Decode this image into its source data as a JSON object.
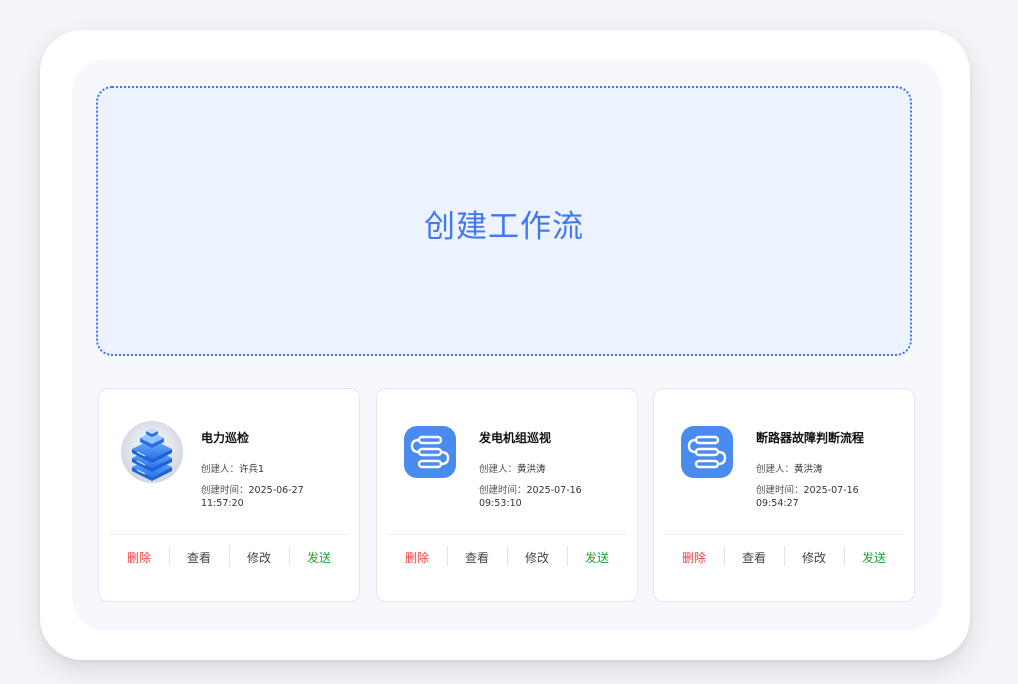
{
  "create_area": {
    "label": "创建工作流"
  },
  "labels": {
    "creator": "创建人：",
    "created_time": "创建时间："
  },
  "actions": {
    "delete": "删除",
    "view": "查看",
    "edit": "修改",
    "send": "发送"
  },
  "cards": [
    {
      "title": "电力巡检",
      "creator": "许兵1",
      "created_date": "2025-06-27",
      "created_clock": "11:57:20",
      "icon": "server-stack-icon"
    },
    {
      "title": "发电机组巡视",
      "creator": "黄洪涛",
      "created_date": "2025-07-16",
      "created_clock": "09:53:10",
      "icon": "workflow-icon"
    },
    {
      "title": "断路器故障判断流程",
      "creator": "黄洪涛",
      "created_date": "2025-07-16",
      "created_clock": "09:54:27",
      "icon": "workflow-icon"
    }
  ],
  "colors": {
    "accent": "#3f78ef",
    "delete": "#f2403c",
    "send": "#22a238",
    "icon_blue": "#4a8bf0"
  }
}
